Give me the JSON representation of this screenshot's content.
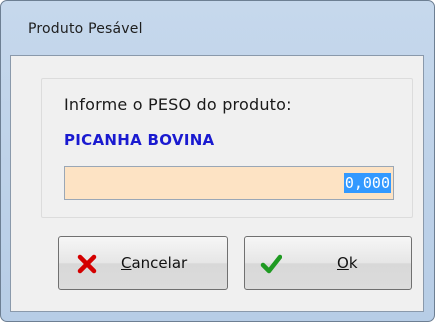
{
  "window": {
    "title": "Produto Pesável"
  },
  "form": {
    "prompt": "Informe o PESO do produto:",
    "product_name": "PICANHA BOVINA",
    "weight_value": "0,000"
  },
  "buttons": {
    "cancel": {
      "mnemonic": "C",
      "rest": "ancelar",
      "icon": "red-x-icon"
    },
    "ok": {
      "mnemonic": "O",
      "rest": "k",
      "icon": "green-check-icon"
    }
  },
  "colors": {
    "product_text": "#1a1ad0",
    "input_background": "#fde3c4",
    "selection": "#3399ff",
    "cancel_icon": "#d40000",
    "ok_icon": "#1f9a22"
  }
}
